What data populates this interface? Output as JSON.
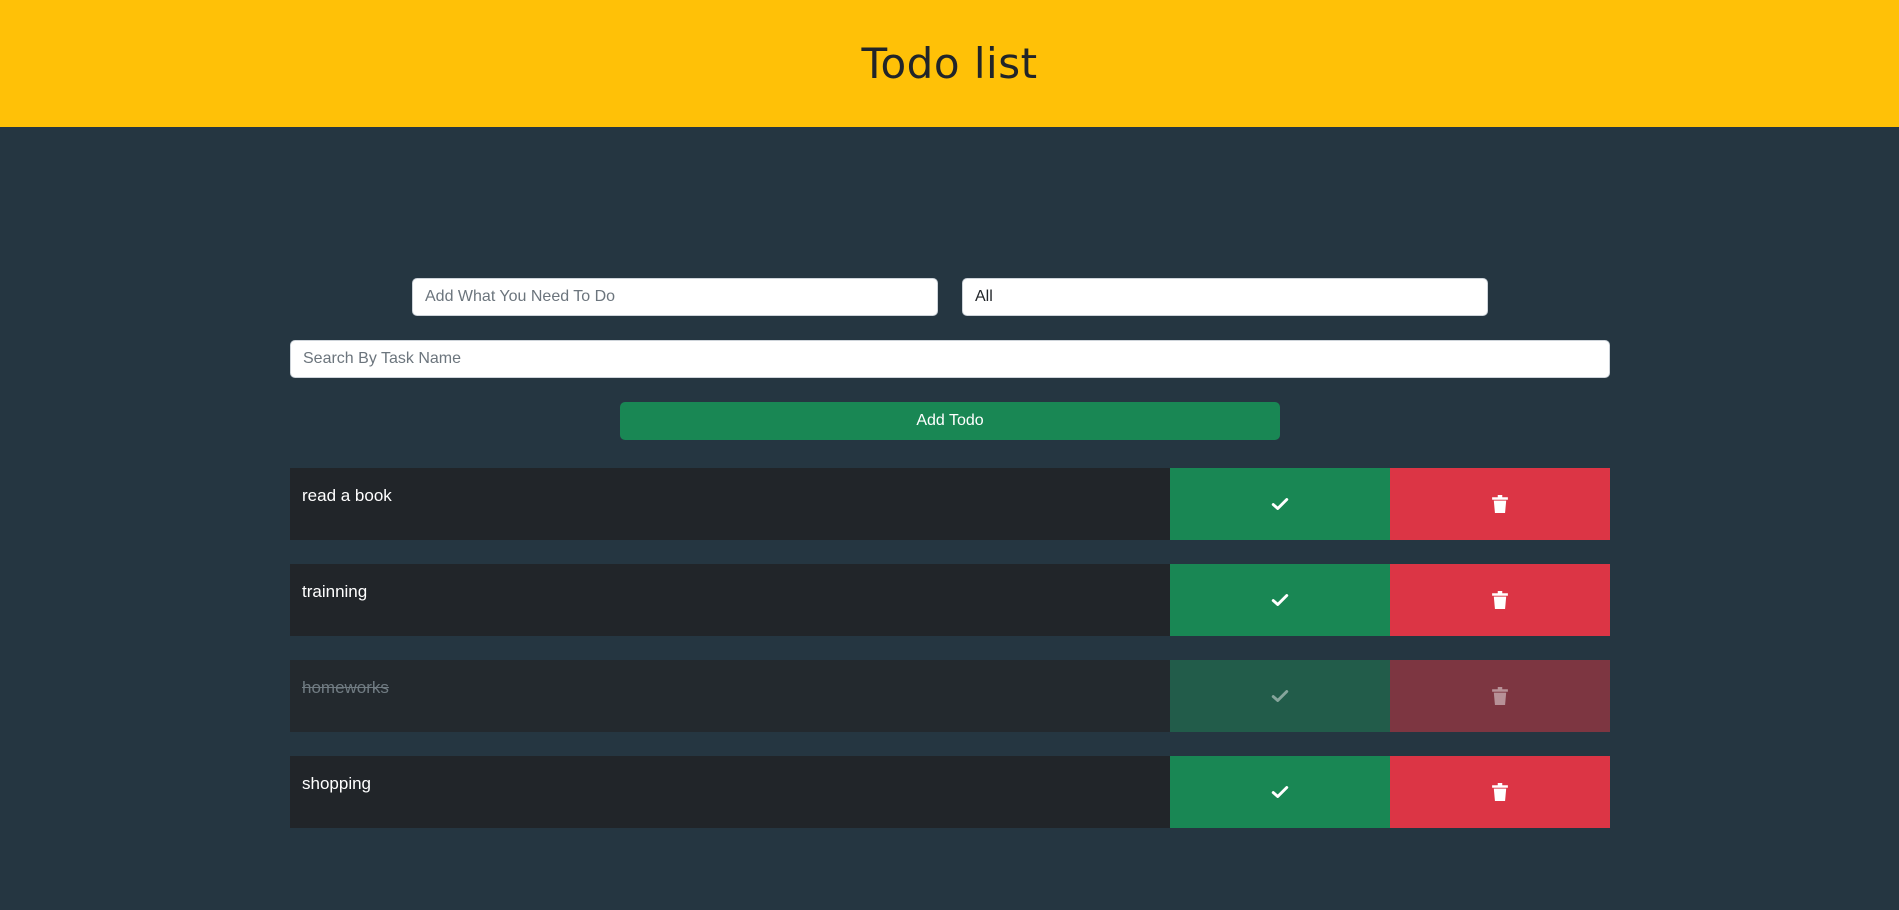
{
  "app": {
    "title": "Todo list"
  },
  "form": {
    "todo_placeholder": "Add What You Need To Do",
    "filter_selected": "All",
    "search_placeholder": "Search By Task Name",
    "add_button_label": "Add Todo"
  },
  "todos": [
    {
      "text": "read a book",
      "completed": false
    },
    {
      "text": "trainning",
      "completed": false
    },
    {
      "text": "homeworks",
      "completed": true
    },
    {
      "text": "shopping",
      "completed": false
    }
  ],
  "icons": {
    "complete": "check-icon",
    "delete": "trash-icon"
  },
  "colors": {
    "header": "#ffc107",
    "background": "#253641",
    "success": "#198754",
    "danger": "#dc3545"
  }
}
